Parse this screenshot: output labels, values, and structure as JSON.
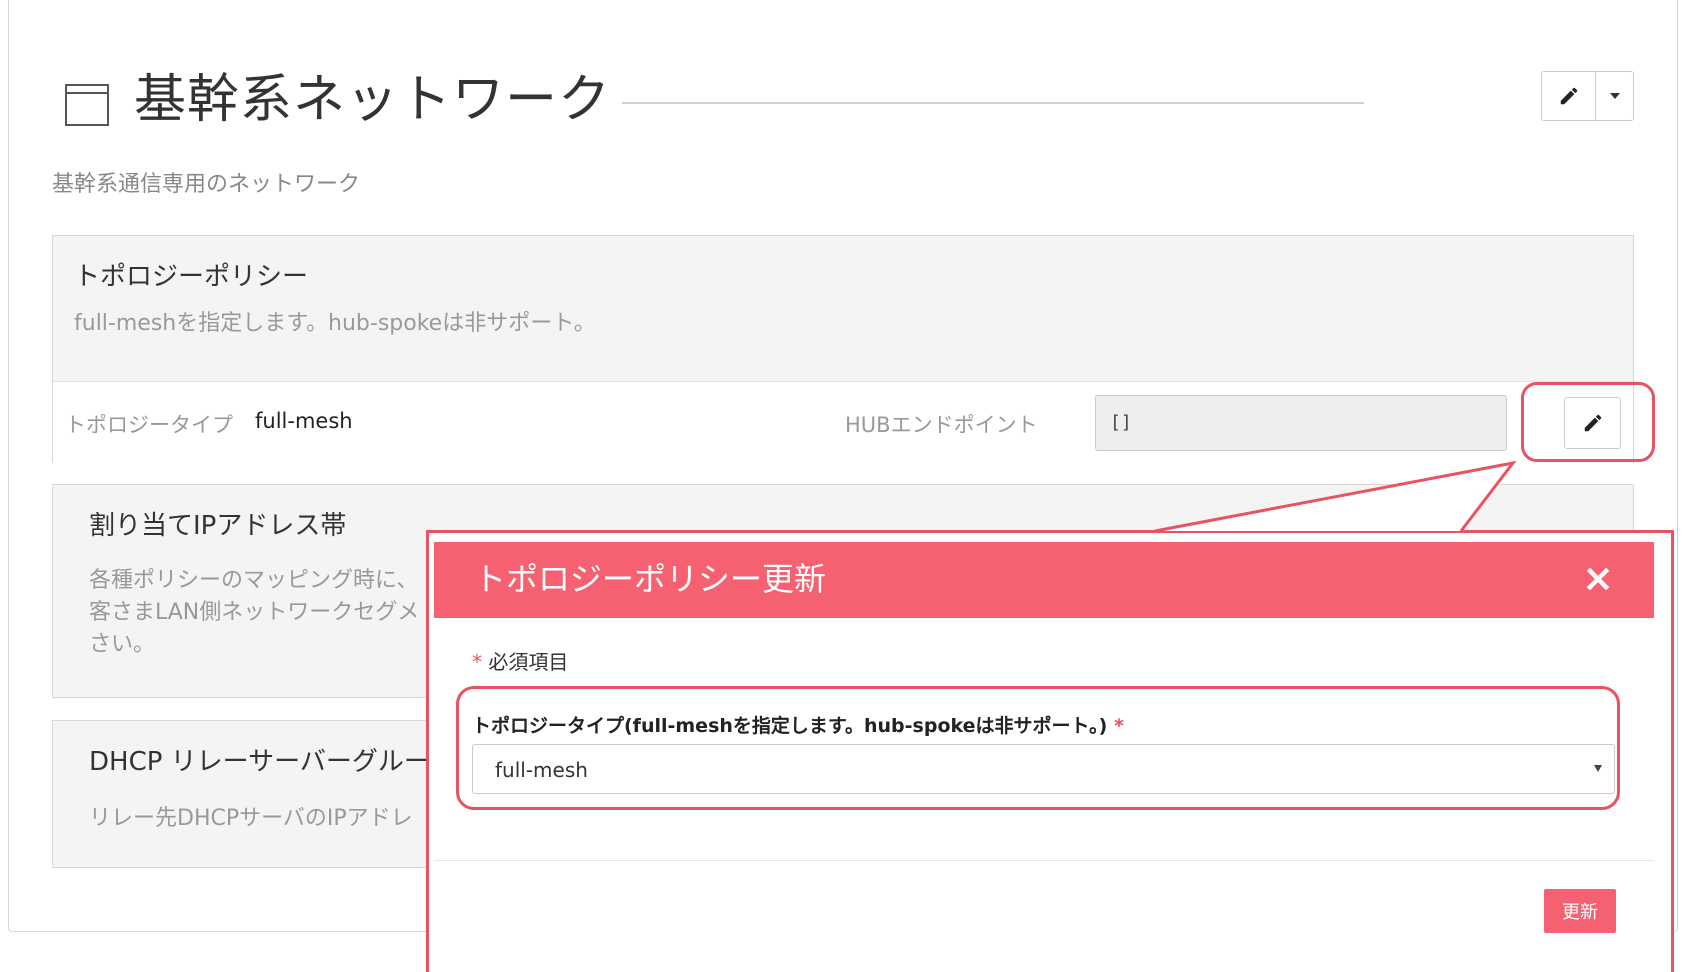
{
  "page": {
    "title": "基幹系ネットワーク",
    "description": "基幹系通信専用のネットワーク"
  },
  "icons": {
    "title_icon": "window-icon",
    "edit_icon": "pencil-icon",
    "caret_icon": "caret-down-icon",
    "close_icon": "close-icon",
    "select_icon": "chevron-down-icon"
  },
  "colors": {
    "accent": "#f56171",
    "highlight": "#e8535f"
  },
  "panels": {
    "topology": {
      "title": "トポロジーポリシー",
      "description": "full-meshを指定します。hub-spokeは非サポート。",
      "type_label": "トポロジータイプ",
      "type_value": "full-mesh",
      "hub_label": "HUBエンドポイント",
      "hub_value": "[]"
    },
    "ip": {
      "title": "割り当てIPアドレス帯",
      "description_lines": [
        "各種ポリシーのマッピング時に、",
        "客さまLAN側ネットワークセグメ",
        "さい。"
      ]
    },
    "dhcp": {
      "title": "DHCP リレーサーバーグルー",
      "description": "リレー先DHCPサーバのIPアドレ"
    }
  },
  "modal": {
    "title": "トポロジーポリシー更新",
    "close_label": "×",
    "required_star": "*",
    "required_note": "必須項目",
    "field_label": "トポロジータイプ(full-meshを指定します。hub-spokeは非サポート。)",
    "field_star": "*",
    "select_value": "full-mesh",
    "submit_label": "更新"
  }
}
